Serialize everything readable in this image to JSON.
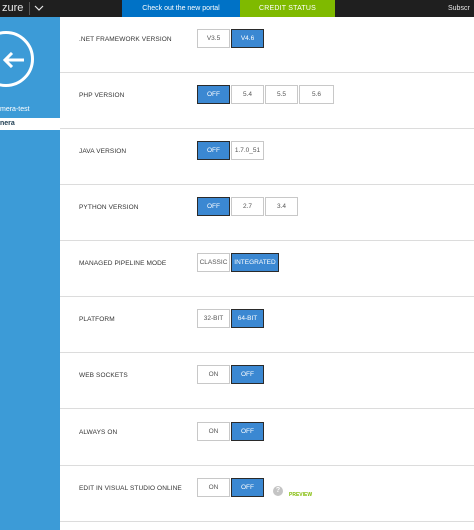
{
  "topbar": {
    "brand": "zure",
    "portal_link": "Check out the new portal",
    "credit_status": "CREDIT STATUS",
    "subscriptions": "Subscr"
  },
  "sidebar": {
    "items": [
      {
        "label": "mera-test"
      },
      {
        "label": "nera"
      }
    ]
  },
  "settings": [
    {
      "label": ".NET FRAMEWORK VERSION",
      "options": [
        "V3.5",
        "V4.6"
      ],
      "selected": "V4.6"
    },
    {
      "label": "PHP VERSION",
      "options": [
        "OFF",
        "5.4",
        "5.5",
        "5.6"
      ],
      "selected": "OFF"
    },
    {
      "label": "JAVA VERSION",
      "options": [
        "OFF",
        "1.7.0_51"
      ],
      "selected": "OFF"
    },
    {
      "label": "PYTHON VERSION",
      "options": [
        "OFF",
        "2.7",
        "3.4"
      ],
      "selected": "OFF"
    },
    {
      "label": "MANAGED PIPELINE MODE",
      "options": [
        "CLASSIC",
        "INTEGRATED"
      ],
      "selected": "INTEGRATED"
    },
    {
      "label": "PLATFORM",
      "options": [
        "32-BIT",
        "64-BIT"
      ],
      "selected": "64-BIT"
    },
    {
      "label": "WEB SOCKETS",
      "options": [
        "ON",
        "OFF"
      ],
      "selected": "OFF"
    },
    {
      "label": "ALWAYS ON",
      "options": [
        "ON",
        "OFF"
      ],
      "selected": "OFF"
    },
    {
      "label": "EDIT IN VISUAL STUDIO ONLINE",
      "options": [
        "ON",
        "OFF"
      ],
      "selected": "OFF"
    }
  ],
  "help_icon": "?",
  "preview_badge": "PREVIEW",
  "colors": {
    "accent": "#3b88d2",
    "sidebar": "#3c9bd7",
    "portal": "#0072c6",
    "credit": "#7fba00",
    "topbar": "#1f1f1f"
  }
}
